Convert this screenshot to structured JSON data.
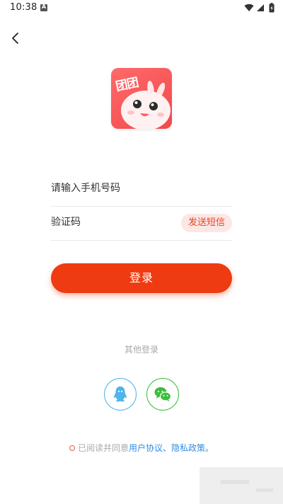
{
  "status_bar": {
    "time": "10:38",
    "notification_letter": "A"
  },
  "login": {
    "phone_placeholder": "请输入手机号码",
    "code_placeholder": "验证码",
    "send_sms_label": "发送短信",
    "login_label": "登录",
    "other_login_label": "其他登录"
  },
  "agreement": {
    "prefix": "已阅读并同意",
    "user_agreement": "用户协议",
    "separator": "、",
    "privacy_policy": "隐私政策",
    "suffix": "。"
  },
  "logo": {
    "text": "团团"
  },
  "colors": {
    "primary": "#ef3b12",
    "sms_bg": "#fde7e4",
    "link": "#2f8de4",
    "qq": "#4fb5ea",
    "wechat": "#3bbf3b"
  }
}
